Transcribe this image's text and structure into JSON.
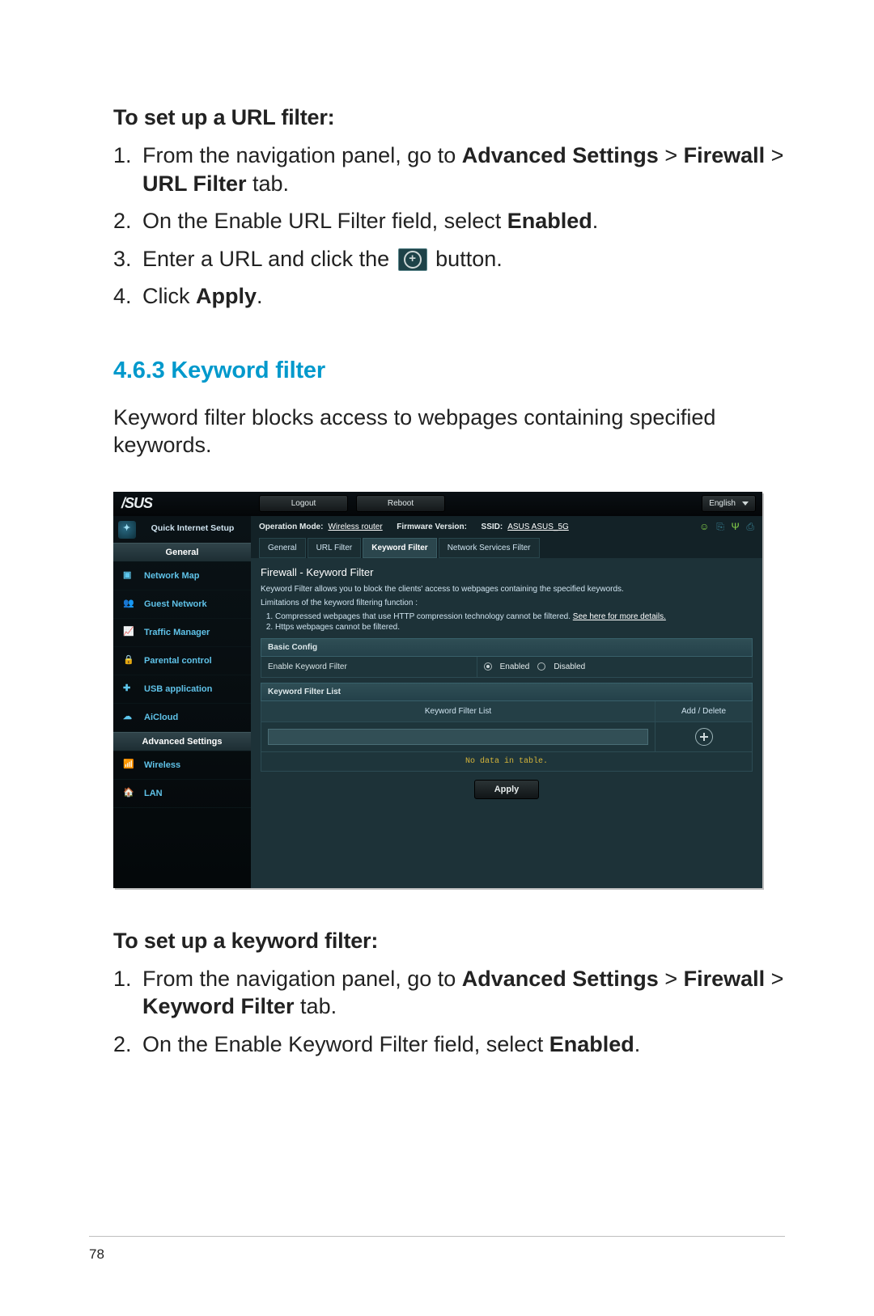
{
  "doc": {
    "url_filter_heading": "To set up a URL filter:",
    "url_steps": {
      "s1a": "From the navigation panel, go to ",
      "s1b": "Advanced Settings",
      "s1c": " > ",
      "s1d": "Firewall",
      "s1e": " > ",
      "s1f": "URL Filter",
      "s1g": " tab.",
      "s2a": "On the Enable URL Filter field, select ",
      "s2b": "Enabled",
      "s2c": ".",
      "s3a": "Enter a URL and click the ",
      "s3b": " button.",
      "s4a": "Click ",
      "s4b": "Apply",
      "s4c": "."
    },
    "section_number": "4.6.3",
    "section_title": "Keyword filter",
    "section_intro": "Keyword filter blocks access to webpages containing specified keywords.",
    "kw_filter_heading": "To set up a keyword filter:",
    "kw_steps": {
      "s1a": "From the navigation panel, go to ",
      "s1b": "Advanced Settings",
      "s1c": " > ",
      "s1d": "Firewall",
      "s1e": " > ",
      "s1f": "Keyword Filter",
      "s1g": " tab.",
      "s2a": "On the Enable Keyword Filter field, select ",
      "s2b": "Enabled",
      "s2c": "."
    },
    "page_number": "78"
  },
  "ui": {
    "brand": "/SUS",
    "logout": "Logout",
    "reboot": "Reboot",
    "lang": "English",
    "info": {
      "op_label": "Operation Mode:",
      "op_value": "Wireless router",
      "fw_label": "Firmware Version:",
      "ssid_label": "SSID:",
      "ssid_value": "ASUS  ASUS_5G"
    },
    "tabs": [
      "General",
      "URL Filter",
      "Keyword Filter",
      "Network Services Filter"
    ],
    "sidebar": {
      "qis": "Quick Internet Setup",
      "group1": "General",
      "items1": [
        "Network Map",
        "Guest Network",
        "Traffic Manager",
        "Parental control",
        "USB application",
        "AiCloud"
      ],
      "group2": "Advanced Settings",
      "items2": [
        "Wireless",
        "LAN"
      ]
    },
    "panel": {
      "title": "Firewall - Keyword Filter",
      "desc": "Keyword Filter allows you to block the clients' access to webpages containing the specified keywords.",
      "limit_label": "Limitations of the keyword filtering function :",
      "limit1a": "Compressed webpages that use HTTP compression technology cannot be filtered. ",
      "limit1b": "See here for more details.",
      "limit2": "Https webpages cannot be filtered.",
      "basic": "Basic Config",
      "enable_label": "Enable Keyword Filter",
      "enabled": "Enabled",
      "disabled": "Disabled",
      "list_bar": "Keyword Filter List",
      "th1": "Keyword Filter List",
      "th2": "Add / Delete",
      "empty": "No data in table.",
      "apply": "Apply"
    }
  }
}
